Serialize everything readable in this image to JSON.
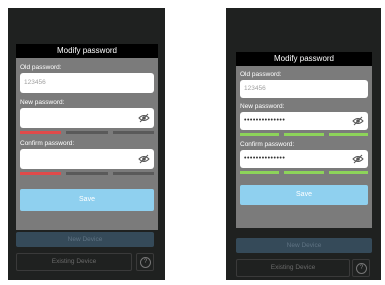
{
  "colors": {
    "phone_bg": "#1f2120",
    "dialog_bg": "#7b7b7b",
    "save_button": "#8fd0ef",
    "strength_weak": "#e04a4a",
    "strength_empty": "#5a5a5a",
    "strength_strong": "#8dd35a"
  },
  "left": {
    "title": "Modify password",
    "old_label": "Old password:",
    "old_placeholder": "123456",
    "new_label": "New password:",
    "new_value": "",
    "confirm_label": "Confirm password:",
    "confirm_value": "",
    "save": "Save",
    "new_device": "New Device",
    "existing_device": "Existing Device",
    "help": "?",
    "new_strength": [
      "weak",
      "empty",
      "empty"
    ],
    "confirm_strength": [
      "weak",
      "empty",
      "empty"
    ]
  },
  "right": {
    "title": "Modify password",
    "old_label": "Old password:",
    "old_placeholder": "123456",
    "new_label": "New password:",
    "new_value": "••••••••••••••",
    "confirm_label": "Confirm password:",
    "confirm_value": "••••••••••••••",
    "save": "Save",
    "new_device": "New Device",
    "existing_device": "Existing Device",
    "help": "?",
    "new_strength": [
      "strong",
      "strong",
      "strong"
    ],
    "confirm_strength": [
      "strong",
      "strong",
      "strong"
    ]
  }
}
